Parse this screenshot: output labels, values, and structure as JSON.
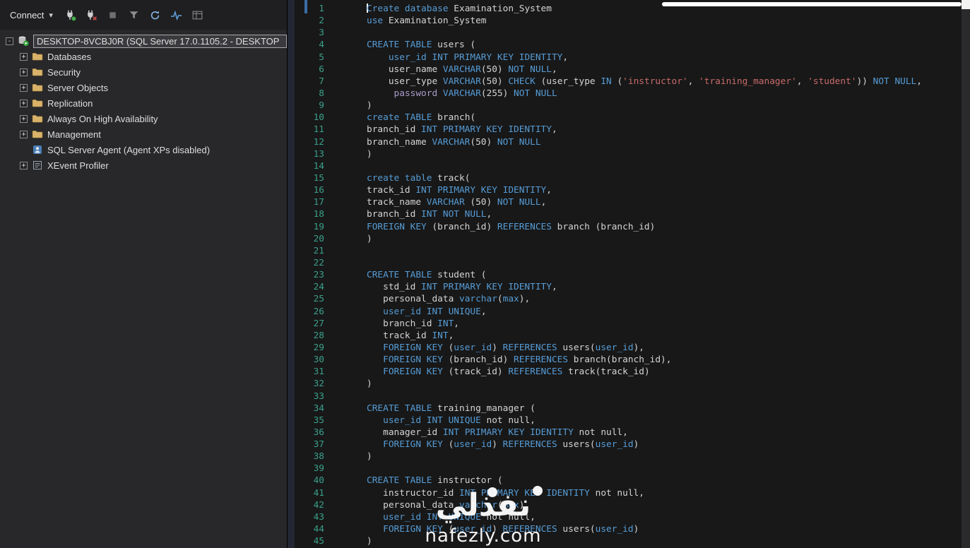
{
  "object_explorer": {
    "toolbar": {
      "connect_label": "Connect"
    },
    "tree": {
      "root_label": "DESKTOP-8VCBJ0R (SQL Server 17.0.1105.2 - DESKTOP",
      "root_expander": "-",
      "items": [
        {
          "label": "Databases",
          "icon": "folder",
          "expander": "+"
        },
        {
          "label": "Security",
          "icon": "folder",
          "expander": "+"
        },
        {
          "label": "Server Objects",
          "icon": "folder",
          "expander": "+"
        },
        {
          "label": "Replication",
          "icon": "folder",
          "expander": "+"
        },
        {
          "label": "Always On High Availability",
          "icon": "folder",
          "expander": "+"
        },
        {
          "label": "Management",
          "icon": "folder",
          "expander": "+"
        },
        {
          "label": "SQL Server Agent (Agent XPs disabled)",
          "icon": "agent",
          "expander": ""
        },
        {
          "label": "XEvent Profiler",
          "icon": "xevent",
          "expander": "+"
        }
      ]
    }
  },
  "editor": {
    "caret_line": 1,
    "lines": [
      [
        [
          "k",
          "Create database "
        ],
        [
          "p",
          "Examination_System"
        ]
      ],
      [
        [
          "k",
          "use "
        ],
        [
          "p",
          "Examination_System"
        ]
      ],
      [],
      [
        [
          "k",
          "CREATE TABLE "
        ],
        [
          "p",
          "users ("
        ]
      ],
      [
        [
          "p",
          "    "
        ],
        [
          "k",
          "user_id INT PRIMARY KEY IDENTITY"
        ],
        [
          "p",
          ","
        ]
      ],
      [
        [
          "p",
          "    user_name "
        ],
        [
          "k",
          "VARCHAR"
        ],
        [
          "p",
          "(50) "
        ],
        [
          "k",
          "NOT NULL"
        ],
        [
          "p",
          ","
        ]
      ],
      [
        [
          "p",
          "    user_type "
        ],
        [
          "k",
          "VARCHAR"
        ],
        [
          "p",
          "(50) "
        ],
        [
          "k",
          "CHECK "
        ],
        [
          "p",
          "(user_type "
        ],
        [
          "k",
          "IN "
        ],
        [
          "p",
          "("
        ],
        [
          "s",
          "'instructor'"
        ],
        [
          "p",
          ", "
        ],
        [
          "s",
          "'training_manager'"
        ],
        [
          "p",
          ", "
        ],
        [
          "s",
          "'student'"
        ],
        [
          "p",
          ")) "
        ],
        [
          "k",
          "NOT NULL"
        ],
        [
          "p",
          ","
        ]
      ],
      [
        [
          "p",
          "     "
        ],
        [
          "m",
          "password "
        ],
        [
          "k",
          "VARCHAR"
        ],
        [
          "p",
          "(255) "
        ],
        [
          "k",
          "NOT NULL"
        ]
      ],
      [
        [
          "p",
          ")"
        ]
      ],
      [
        [
          "k",
          "create TABLE "
        ],
        [
          "p",
          "branch("
        ]
      ],
      [
        [
          "p",
          "branch_id "
        ],
        [
          "k",
          "INT PRIMARY KEY IDENTITY"
        ],
        [
          "p",
          ","
        ]
      ],
      [
        [
          "p",
          "branch_name "
        ],
        [
          "k",
          "VARCHAR"
        ],
        [
          "p",
          "(50) "
        ],
        [
          "k",
          "NOT NULL"
        ]
      ],
      [
        [
          "p",
          ")"
        ]
      ],
      [],
      [
        [
          "k",
          "create table "
        ],
        [
          "p",
          "track("
        ]
      ],
      [
        [
          "p",
          "track_id "
        ],
        [
          "k",
          "INT PRIMARY KEY IDENTITY"
        ],
        [
          "p",
          ","
        ]
      ],
      [
        [
          "p",
          "track_name "
        ],
        [
          "k",
          "VARCHAR "
        ],
        [
          "p",
          "(50) "
        ],
        [
          "k",
          "NOT NULL"
        ],
        [
          "p",
          ","
        ]
      ],
      [
        [
          "p",
          "branch_id "
        ],
        [
          "k",
          "INT NOT NULL"
        ],
        [
          "p",
          ","
        ]
      ],
      [
        [
          "k",
          "FOREIGN KEY "
        ],
        [
          "p",
          "(branch_id) "
        ],
        [
          "k",
          "REFERENCES "
        ],
        [
          "p",
          "branch (branch_id)"
        ]
      ],
      [
        [
          "p",
          ")"
        ]
      ],
      [],
      [],
      [
        [
          "k",
          "CREATE TABLE "
        ],
        [
          "p",
          "student ("
        ]
      ],
      [
        [
          "p",
          "   std_id "
        ],
        [
          "k",
          "INT PRIMARY KEY IDENTITY"
        ],
        [
          "p",
          ","
        ]
      ],
      [
        [
          "p",
          "   personal_data "
        ],
        [
          "k",
          "varchar"
        ],
        [
          "p",
          "("
        ],
        [
          "k",
          "max"
        ],
        [
          "p",
          "),"
        ]
      ],
      [
        [
          "p",
          "   "
        ],
        [
          "k",
          "user_id INT UNIQUE"
        ],
        [
          "p",
          ","
        ]
      ],
      [
        [
          "p",
          "   branch_id "
        ],
        [
          "k",
          "INT"
        ],
        [
          "p",
          ","
        ]
      ],
      [
        [
          "p",
          "   track_id "
        ],
        [
          "k",
          "INT"
        ],
        [
          "p",
          ","
        ]
      ],
      [
        [
          "p",
          "   "
        ],
        [
          "k",
          "FOREIGN KEY "
        ],
        [
          "p",
          "("
        ],
        [
          "k",
          "user_id"
        ],
        [
          "p",
          ") "
        ],
        [
          "k",
          "REFERENCES "
        ],
        [
          "p",
          "users("
        ],
        [
          "k",
          "user_id"
        ],
        [
          "p",
          "),"
        ]
      ],
      [
        [
          "p",
          "   "
        ],
        [
          "k",
          "FOREIGN KEY "
        ],
        [
          "p",
          "(branch_id) "
        ],
        [
          "k",
          "REFERENCES "
        ],
        [
          "p",
          "branch(branch_id),"
        ]
      ],
      [
        [
          "p",
          "   "
        ],
        [
          "k",
          "FOREIGN KEY "
        ],
        [
          "p",
          "(track_id) "
        ],
        [
          "k",
          "REFERENCES "
        ],
        [
          "p",
          "track(track_id)"
        ]
      ],
      [
        [
          "p",
          ")"
        ]
      ],
      [],
      [
        [
          "k",
          "CREATE TABLE "
        ],
        [
          "p",
          "training_manager ("
        ]
      ],
      [
        [
          "p",
          "   "
        ],
        [
          "k",
          "user_id INT UNIQUE "
        ],
        [
          "p",
          "not null,"
        ]
      ],
      [
        [
          "p",
          "   manager_id "
        ],
        [
          "k",
          "INT PRIMARY KEY IDENTITY "
        ],
        [
          "p",
          "not null,"
        ]
      ],
      [
        [
          "p",
          "   "
        ],
        [
          "k",
          "FOREIGN KEY "
        ],
        [
          "p",
          "("
        ],
        [
          "k",
          "user_id"
        ],
        [
          "p",
          ") "
        ],
        [
          "k",
          "REFERENCES "
        ],
        [
          "p",
          "users("
        ],
        [
          "k",
          "user_id"
        ],
        [
          "p",
          ")"
        ]
      ],
      [
        [
          "p",
          ")"
        ]
      ],
      [],
      [
        [
          "k",
          "CREATE TABLE "
        ],
        [
          "p",
          "instructor ("
        ]
      ],
      [
        [
          "p",
          "   instructor_id "
        ],
        [
          "k",
          "INT PRIMARY KEY IDENTITY "
        ],
        [
          "p",
          "not null,"
        ]
      ],
      [
        [
          "p",
          "   personal_data "
        ],
        [
          "k",
          "varchar"
        ],
        [
          "p",
          "("
        ],
        [
          "k",
          "max"
        ],
        [
          "p",
          "),"
        ]
      ],
      [
        [
          "p",
          "   "
        ],
        [
          "k",
          "user_id INT UNIQUE "
        ],
        [
          "p",
          "not null,"
        ]
      ],
      [
        [
          "p",
          "   "
        ],
        [
          "k",
          "FOREIGN KEY "
        ],
        [
          "p",
          "("
        ],
        [
          "k",
          "user_id"
        ],
        [
          "p",
          ") "
        ],
        [
          "k",
          "REFERENCES "
        ],
        [
          "p",
          "users("
        ],
        [
          "k",
          "user_id"
        ],
        [
          "p",
          ")"
        ]
      ],
      [
        [
          "p",
          ")"
        ]
      ]
    ]
  },
  "watermark": {
    "arabic": "نفذلي",
    "site": "nafezly.com"
  }
}
